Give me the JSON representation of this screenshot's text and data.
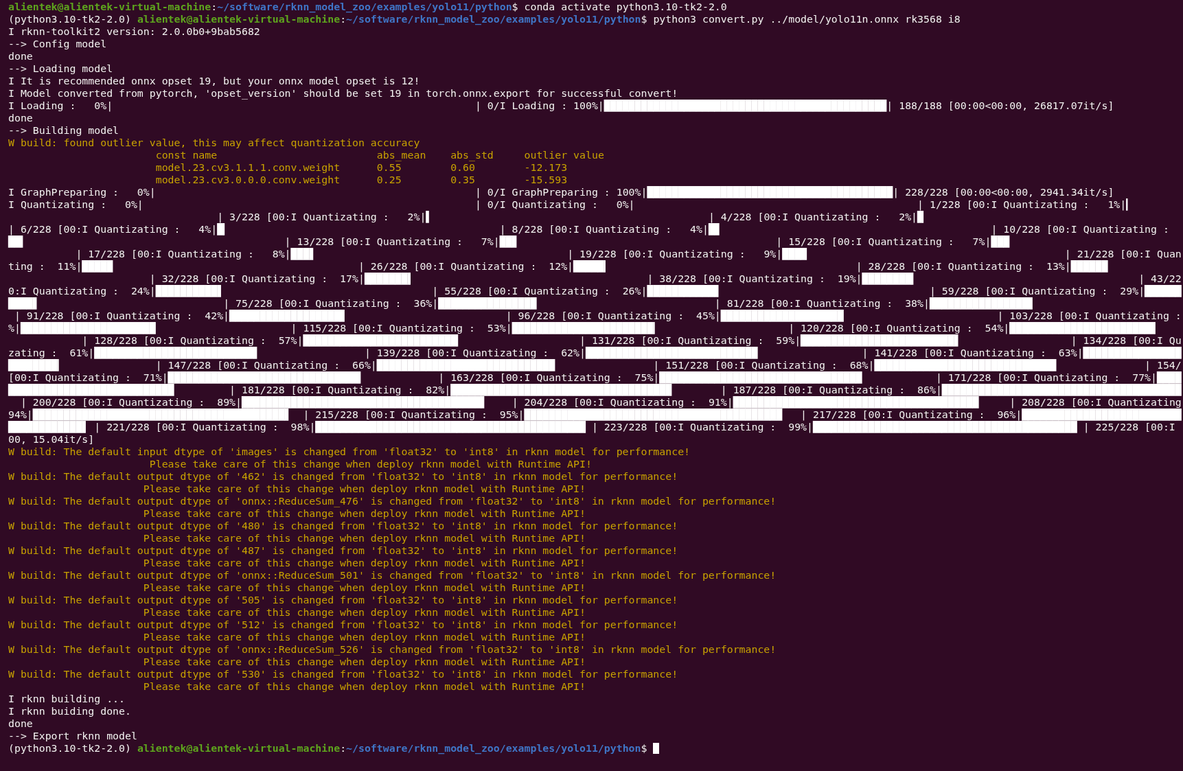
{
  "lines": [
    [
      {
        "kind": "user",
        "text": "alientek@alientek-virtual-machine"
      },
      {
        "kind": "sep",
        "text": ":"
      },
      {
        "kind": "path",
        "text": "~/software/rknn_model_zoo/examples/yolo11/python"
      },
      {
        "kind": "sep",
        "text": "$"
      },
      {
        "kind": "cmd",
        "text": " conda activate python3.10-tk2-2.0"
      }
    ],
    [
      {
        "kind": "env",
        "text": "(python3.10-tk2-2.0)"
      },
      {
        "kind": "user",
        "text": " alientek@alientek-virtual-machine"
      },
      {
        "kind": "sep",
        "text": ":"
      },
      {
        "kind": "path",
        "text": "~/software/rknn_model_zoo/examples/yolo11/python"
      },
      {
        "kind": "sep",
        "text": "$"
      },
      {
        "kind": "cmd",
        "text": " python3 convert.py ../model/yolo11n.onnx rk3568 i8"
      }
    ],
    [
      {
        "kind": "out",
        "text": "I rknn-toolkit2 version: 2.0.0b0+9bab5682"
      }
    ],
    [
      {
        "kind": "out",
        "text": "--> Config model"
      }
    ],
    [
      {
        "kind": "out",
        "text": "done"
      }
    ],
    [
      {
        "kind": "out",
        "text": "--> Loading model"
      }
    ],
    [
      {
        "kind": "out",
        "text": "I It is recommended onnx opset 19, but your onnx model opset is 12!"
      }
    ],
    [
      {
        "kind": "out",
        "text": "I Model converted from pytorch, 'opset_version' should be set 19 in torch.onnx.export for successful convert!"
      }
    ],
    [
      {
        "kind": "out",
        "text": "I Loading :   0%|"
      },
      {
        "kind": "out",
        "text": "                                                           | 0/I Loading : 100%|"
      },
      {
        "kind": "bar",
        "text": "██████████████████████████████████████████████"
      },
      {
        "kind": "out",
        "text": "| 188/188 [00:00<00:00, 26817.07it/s]"
      }
    ],
    [
      {
        "kind": "out",
        "text": "done"
      }
    ],
    [
      {
        "kind": "out",
        "text": "--> Building model"
      }
    ],
    [
      {
        "kind": "warn",
        "text": "W build: found outlier value, this may affect quantization accuracy"
      }
    ],
    [
      {
        "kind": "warn",
        "text": "                        const name"
      },
      {
        "kind": "warn",
        "text": "                          abs_mean"
      },
      {
        "kind": "warn",
        "text": "    abs_std"
      },
      {
        "kind": "warn",
        "text": "     outlier value"
      }
    ],
    [
      {
        "kind": "warn",
        "text": "                        model.23.cv3.1.1.1.conv.weight"
      },
      {
        "kind": "warn",
        "text": "      0.55"
      },
      {
        "kind": "warn",
        "text": "        0.60"
      },
      {
        "kind": "warn",
        "text": "        -12.173"
      }
    ],
    [
      {
        "kind": "warn",
        "text": "                        model.23.cv3.0.0.0.conv.weight"
      },
      {
        "kind": "warn",
        "text": "      0.25"
      },
      {
        "kind": "warn",
        "text": "        0.35"
      },
      {
        "kind": "warn",
        "text": "        -15.593"
      }
    ],
    [
      {
        "kind": "out",
        "text": "I GraphPreparing :   0%|"
      },
      {
        "kind": "out",
        "text": "                                                    | 0/I GraphPreparing : 100%|"
      },
      {
        "kind": "bar",
        "text": "████████████████████████████████████████"
      },
      {
        "kind": "out",
        "text": "| 228/228 [00:00<00:00, 2941.34it/s]"
      }
    ],
    [
      {
        "kind": "out",
        "text": "I Quantizating :   0%|"
      },
      {
        "kind": "out",
        "text": "                                                      | 0/I Quantizating :   0%|"
      },
      {
        "kind": "out",
        "text": "                                              | 1/228 [00:I Quantizating :   1%|"
      },
      {
        "kind": "bar",
        "text": "▎"
      }
    ],
    [
      {
        "kind": "out",
        "text": "                                  | 3/228 [00:I Quantizating :   2%|"
      },
      {
        "kind": "bar",
        "text": "▌"
      },
      {
        "kind": "out",
        "text": "                                             | 4/228 [00:I Quantizating :   2%|"
      },
      {
        "kind": "bar",
        "text": "█"
      }
    ],
    [
      {
        "kind": "out",
        "text": "| 6/228 [00:I Quantizating :   4%|"
      },
      {
        "kind": "bar",
        "text": "█▎"
      },
      {
        "kind": "out",
        "text": "                                            | 8/228 [00:I Quantizating :   4%|"
      },
      {
        "kind": "bar",
        "text": "█▊"
      },
      {
        "kind": "out",
        "text": "                                            | 10/228 [00:I Quantizating :"
      }
    ],
    [
      {
        "kind": "bar",
        "text": "██▍"
      },
      {
        "kind": "out",
        "text": "                                          | 13/228 [00:I Quantizating :   7%|"
      },
      {
        "kind": "bar",
        "text": "██▊"
      },
      {
        "kind": "out",
        "text": "                                          | 15/228 [00:I Quantizating :   7%|"
      },
      {
        "kind": "bar",
        "text": "███"
      }
    ],
    [
      {
        "kind": "out",
        "text": "           | 17/228 [00:I Quantizating :   8%|"
      },
      {
        "kind": "bar",
        "text": "███▋"
      },
      {
        "kind": "out",
        "text": "                                         | 19/228 [00:I Quantizating :   9%|"
      },
      {
        "kind": "bar",
        "text": "████"
      },
      {
        "kind": "out",
        "text": "                                          | 21/228 [00:I Quan"
      }
    ],
    [
      {
        "kind": "out",
        "text": "ting :  11%|"
      },
      {
        "kind": "bar",
        "text": "█████"
      },
      {
        "kind": "out",
        "text": "                                        | 26/228 [00:I Quantizating :  12%|"
      },
      {
        "kind": "bar",
        "text": "█████▎"
      },
      {
        "kind": "out",
        "text": "                                        | 28/228 [00:I Quantizating :  13%|"
      },
      {
        "kind": "bar",
        "text": "██████"
      }
    ],
    [
      {
        "kind": "out",
        "text": "                       | 32/228 [00:I Quantizating :  17%|"
      },
      {
        "kind": "bar",
        "text": "███████▌"
      },
      {
        "kind": "out",
        "text": "                                      | 38/228 [00:I Quantizating :  19%|"
      },
      {
        "kind": "bar",
        "text": "████████▍"
      },
      {
        "kind": "out",
        "text": "                                    | 43/22"
      }
    ],
    [
      {
        "kind": "out",
        "text": "0:I Quantizating :  24%|"
      },
      {
        "kind": "bar",
        "text": "██████████▋"
      },
      {
        "kind": "out",
        "text": "                                  | 55/228 [00:I Quantizating :  26%|"
      },
      {
        "kind": "bar",
        "text": "███████████▋"
      },
      {
        "kind": "out",
        "text": "                                  | 59/228 [00:I Quantizating :  29%|"
      },
      {
        "kind": "bar",
        "text": "██████"
      }
    ],
    [
      {
        "kind": "bar",
        "text": "████▋"
      },
      {
        "kind": "out",
        "text": "                              | 75/228 [00:I Quantizating :  36%|"
      },
      {
        "kind": "bar",
        "text": "████████████████"
      },
      {
        "kind": "out",
        "text": "                             | 81/228 [00:I Quantizating :  38%|"
      },
      {
        "kind": "bar",
        "text": "████████████████▊"
      }
    ],
    [
      {
        "kind": "out",
        "text": " | 91/228 [00:I Quantizating :  42%|"
      },
      {
        "kind": "bar",
        "text": "██████████████████▊"
      },
      {
        "kind": "out",
        "text": "                          | 96/228 [00:I Quantizating :  45%|"
      },
      {
        "kind": "bar",
        "text": "████████████████████"
      },
      {
        "kind": "out",
        "text": "                         | 103/228 [00:I Quantizating :"
      }
    ],
    [
      {
        "kind": "out",
        "text": "%|"
      },
      {
        "kind": "bar",
        "text": "██████████████████████"
      },
      {
        "kind": "out",
        "text": "                      | 115/228 [00:I Quantizating :  53%|"
      },
      {
        "kind": "bar",
        "text": "███████████████████████▎"
      },
      {
        "kind": "out",
        "text": "                     | 120/228 [00:I Quantizating :  54%|"
      },
      {
        "kind": "bar",
        "text": "███████████████████████▊"
      }
    ],
    [
      {
        "kind": "out",
        "text": "            | 128/228 [00:I Quantizating :  57%|"
      },
      {
        "kind": "bar",
        "text": "█████████████████████████▎"
      },
      {
        "kind": "out",
        "text": "                   | 131/228 [00:I Quantizating :  59%|"
      },
      {
        "kind": "bar",
        "text": "█████████████████████████▋"
      },
      {
        "kind": "out",
        "text": "                  | 134/228 [00:I Qu"
      }
    ],
    [
      {
        "kind": "out",
        "text": "zating :  61%|"
      },
      {
        "kind": "bar",
        "text": "██████████████████████████▌"
      },
      {
        "kind": "out",
        "text": "                 | 139/228 [00:I Quantizating :  62%|"
      },
      {
        "kind": "bar",
        "text": "████████████████████████████"
      },
      {
        "kind": "out",
        "text": "                 | 141/228 [00:I Quantizating :  63%|"
      },
      {
        "kind": "bar",
        "text": "████████████████"
      }
    ],
    [
      {
        "kind": "bar",
        "text": "████████▎"
      },
      {
        "kind": "out",
        "text": "               | 147/228 [00:I Quantizating :  66%|"
      },
      {
        "kind": "bar",
        "text": "█████████████████████████████"
      },
      {
        "kind": "out",
        "text": "                | 151/228 [00:I Quantizating :  68%|"
      },
      {
        "kind": "bar",
        "text": "█████████████████████████████▋"
      },
      {
        "kind": "out",
        "text": "              | 154/"
      }
    ],
    [
      {
        "kind": "out",
        "text": "[00:I Quantizating :  71%|"
      },
      {
        "kind": "bar",
        "text": "███████████████████████████████▍"
      },
      {
        "kind": "out",
        "text": "            | 163/228 [00:I Quantizating :  75%|"
      },
      {
        "kind": "bar",
        "text": "█████████████████████████████████"
      },
      {
        "kind": "out",
        "text": "            | 171/228 [00:I Quantizating :  77%|"
      },
      {
        "kind": "bar",
        "text": "████"
      }
    ],
    [
      {
        "kind": "bar",
        "text": "███████████████████████████"
      },
      {
        "kind": "out",
        "text": "         | 181/228 [00:I Quantizating :  82%|"
      },
      {
        "kind": "bar",
        "text": "████████████████████████████████████"
      },
      {
        "kind": "out",
        "text": "        | 187/228 [00:I Quantizating :  86%|"
      },
      {
        "kind": "bar",
        "text": "███████████████████████████████████████"
      }
    ],
    [
      {
        "kind": "out",
        "text": "  | 200/228 [00:I Quantizating :  89%|"
      },
      {
        "kind": "bar",
        "text": "███████████████████████████████████████▌"
      },
      {
        "kind": "out",
        "text": "    | 204/228 [00:I Quantizating :  91%|"
      },
      {
        "kind": "bar",
        "text": "████████████████████████████████████████"
      },
      {
        "kind": "out",
        "text": "     | 208/228 [00:I Quantizating"
      }
    ],
    [
      {
        "kind": "out",
        "text": "94%|"
      },
      {
        "kind": "bar",
        "text": "█████████████████████████████████████████▋"
      },
      {
        "kind": "out",
        "text": "  | 215/228 [00:I Quantizating :  95%|"
      },
      {
        "kind": "bar",
        "text": "██████████████████████████████████████████"
      },
      {
        "kind": "out",
        "text": "   | 217/228 [00:I Quantizating :  96%|"
      },
      {
        "kind": "bar",
        "text": "██████████████████████████"
      }
    ],
    [
      {
        "kind": "bar",
        "text": "████████████▋"
      },
      {
        "kind": "out",
        "text": " | 221/228 [00:I Quantizating :  98%|"
      },
      {
        "kind": "bar",
        "text": "████████████████████████████████████████████"
      },
      {
        "kind": "out",
        "text": " | 223/228 [00:I Quantizating :  99%|"
      },
      {
        "kind": "bar",
        "text": "███████████████████████████████████████████"
      },
      {
        "kind": "out",
        "text": " | 225/228 [00:I"
      }
    ],
    [
      {
        "kind": "out",
        "text": "00, 15.04it/s]"
      }
    ],
    [
      {
        "kind": "warn",
        "text": "W build: The default input dtype of 'images' is changed from 'float32' to 'int8' in rknn model for performance!"
      }
    ],
    [
      {
        "kind": "warn",
        "text": "                       Please take care of this change when deploy rknn model with Runtime API!"
      }
    ],
    [
      {
        "kind": "warn",
        "text": "W build: The default output dtype of '462' is changed from 'float32' to 'int8' in rknn model for performance!"
      }
    ],
    [
      {
        "kind": "warn",
        "text": "                      Please take care of this change when deploy rknn model with Runtime API!"
      }
    ],
    [
      {
        "kind": "warn",
        "text": "W build: The default output dtype of 'onnx::ReduceSum_476' is changed from 'float32' to 'int8' in rknn model for performance!"
      }
    ],
    [
      {
        "kind": "warn",
        "text": "                      Please take care of this change when deploy rknn model with Runtime API!"
      }
    ],
    [
      {
        "kind": "warn",
        "text": "W build: The default output dtype of '480' is changed from 'float32' to 'int8' in rknn model for performance!"
      }
    ],
    [
      {
        "kind": "warn",
        "text": "                      Please take care of this change when deploy rknn model with Runtime API!"
      }
    ],
    [
      {
        "kind": "warn",
        "text": "W build: The default output dtype of '487' is changed from 'float32' to 'int8' in rknn model for performance!"
      }
    ],
    [
      {
        "kind": "warn",
        "text": "                      Please take care of this change when deploy rknn model with Runtime API!"
      }
    ],
    [
      {
        "kind": "warn",
        "text": "W build: The default output dtype of 'onnx::ReduceSum_501' is changed from 'float32' to 'int8' in rknn model for performance!"
      }
    ],
    [
      {
        "kind": "warn",
        "text": "                      Please take care of this change when deploy rknn model with Runtime API!"
      }
    ],
    [
      {
        "kind": "warn",
        "text": "W build: The default output dtype of '505' is changed from 'float32' to 'int8' in rknn model for performance!"
      }
    ],
    [
      {
        "kind": "warn",
        "text": "                      Please take care of this change when deploy rknn model with Runtime API!"
      }
    ],
    [
      {
        "kind": "warn",
        "text": "W build: The default output dtype of '512' is changed from 'float32' to 'int8' in rknn model for performance!"
      }
    ],
    [
      {
        "kind": "warn",
        "text": "                      Please take care of this change when deploy rknn model with Runtime API!"
      }
    ],
    [
      {
        "kind": "warn",
        "text": "W build: The default output dtype of 'onnx::ReduceSum_526' is changed from 'float32' to 'int8' in rknn model for performance!"
      }
    ],
    [
      {
        "kind": "warn",
        "text": "                      Please take care of this change when deploy rknn model with Runtime API!"
      }
    ],
    [
      {
        "kind": "warn",
        "text": "W build: The default output dtype of '530' is changed from 'float32' to 'int8' in rknn model for performance!"
      }
    ],
    [
      {
        "kind": "warn",
        "text": "                      Please take care of this change when deploy rknn model with Runtime API!"
      }
    ],
    [
      {
        "kind": "out",
        "text": "I rknn building ..."
      }
    ],
    [
      {
        "kind": "out",
        "text": "I rknn buiding done."
      }
    ],
    [
      {
        "kind": "out",
        "text": "done"
      }
    ],
    [
      {
        "kind": "out",
        "text": "--> Export rknn model"
      }
    ],
    [
      {
        "kind": "env",
        "text": "(python3.10-tk2-2.0)"
      },
      {
        "kind": "user",
        "text": " alientek@alientek-virtual-machine"
      },
      {
        "kind": "sep",
        "text": ":"
      },
      {
        "kind": "path",
        "text": "~/software/rknn_model_zoo/examples/yolo11/python"
      },
      {
        "kind": "sep",
        "text": "$"
      }
    ]
  ],
  "cursor": true
}
